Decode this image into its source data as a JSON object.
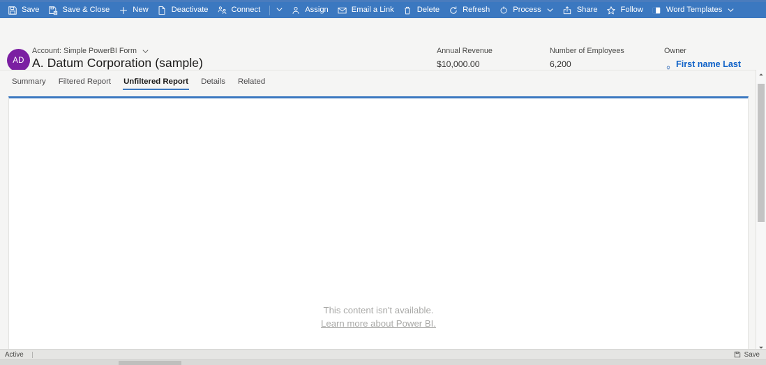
{
  "commandbar": {
    "background": "#3b78c0",
    "items": [
      {
        "label": "Save",
        "icon": "save-icon",
        "caret": false
      },
      {
        "label": "Save & Close",
        "icon": "save-close-icon",
        "caret": false
      },
      {
        "label": "New",
        "icon": "plus-icon",
        "caret": false
      },
      {
        "label": "Deactivate",
        "icon": "page-icon",
        "caret": false
      },
      {
        "label": "Connect",
        "icon": "connect-icon",
        "caret": false,
        "separator_after": true,
        "caret_button": true
      },
      {
        "label": "Assign",
        "icon": "person-icon",
        "caret": false
      },
      {
        "label": "Email a Link",
        "icon": "email-link-icon",
        "caret": false
      },
      {
        "label": "Delete",
        "icon": "trash-icon",
        "caret": false
      },
      {
        "label": "Refresh",
        "icon": "refresh-icon",
        "caret": false
      },
      {
        "label": "Process",
        "icon": "process-icon",
        "caret": true
      },
      {
        "label": "Share",
        "icon": "share-icon",
        "caret": false
      },
      {
        "label": "Follow",
        "icon": "star-icon",
        "caret": false
      },
      {
        "label": "Word Templates",
        "icon": "word-icon",
        "caret": true
      }
    ]
  },
  "record": {
    "avatar_initials": "AD",
    "avatar_color": "#7b1fa2",
    "subtitle": "Account: Simple PowerBI Form",
    "title": "A. Datum Corporation (sample)",
    "fields": [
      {
        "label": "Annual Revenue",
        "value": "$10,000.00",
        "required": false
      },
      {
        "label": "Number of Employees",
        "value": "6,200",
        "required": false
      },
      {
        "label": "Owner",
        "value": "First name Last name",
        "required": true,
        "required_marker": "*",
        "link_color": "#0f62c8"
      }
    ]
  },
  "tabs": {
    "accent": "#3b78c0",
    "items": [
      {
        "label": "Summary",
        "selected": false
      },
      {
        "label": "Filtered Report",
        "selected": false
      },
      {
        "label": "Unfiltered Report",
        "selected": true
      },
      {
        "label": "Details",
        "selected": false
      },
      {
        "label": "Related",
        "selected": false
      }
    ]
  },
  "content": {
    "message_line1": "This content isn't available.",
    "message_line2": "Learn more about Power BI."
  },
  "statusbar": {
    "state": "Active",
    "save_label": "Save",
    "save_icon": "save-icon"
  }
}
